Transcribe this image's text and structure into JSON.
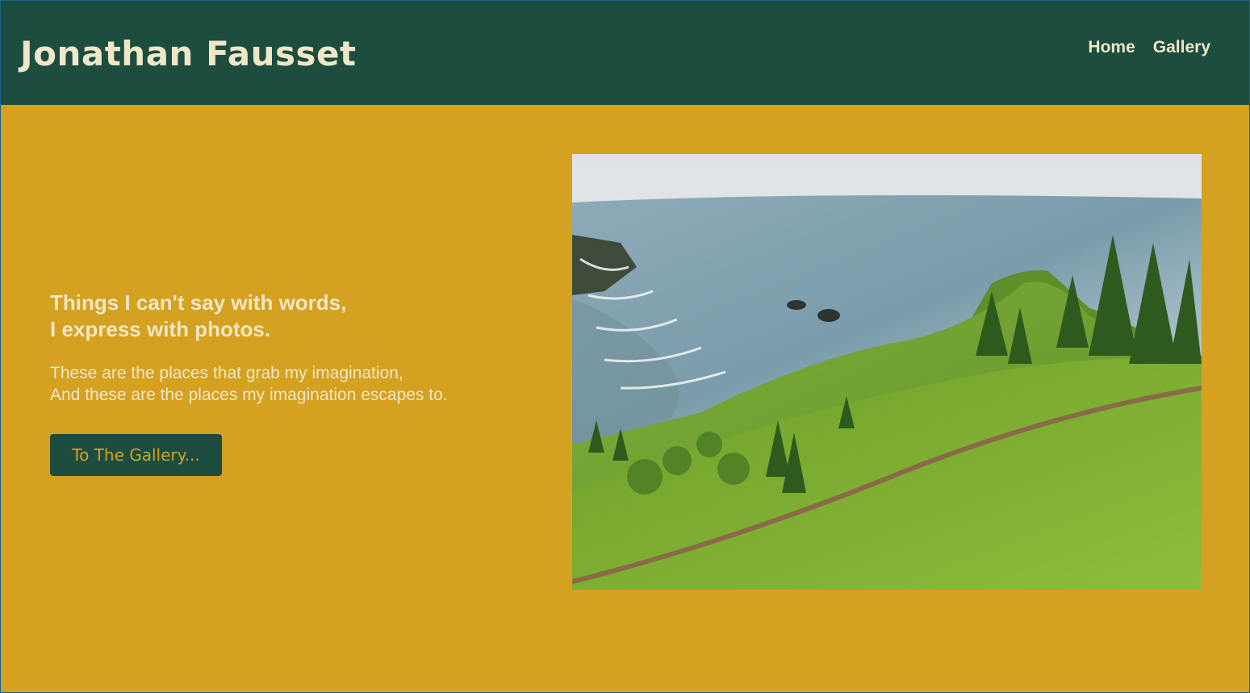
{
  "header": {
    "title": "Jonathan Fausset",
    "nav": [
      {
        "label": "Home"
      },
      {
        "label": "Gallery"
      }
    ]
  },
  "hero": {
    "headline_line1": "Things I can't say with words,",
    "headline_line2": "I express with photos.",
    "subtext_line1": "These are the places that grab my imagination,",
    "subtext_line2": "And these are the places my imagination escapes to.",
    "button_label": "To The Gallery..."
  },
  "colors": {
    "header_bg": "#1c4d3e",
    "page_bg": "#d4a220",
    "text_light": "#f0e6c8",
    "button_bg": "#1c4d3e",
    "button_text": "#d4a220"
  },
  "photo": {
    "subject": "coastal-hillside-landscape"
  }
}
